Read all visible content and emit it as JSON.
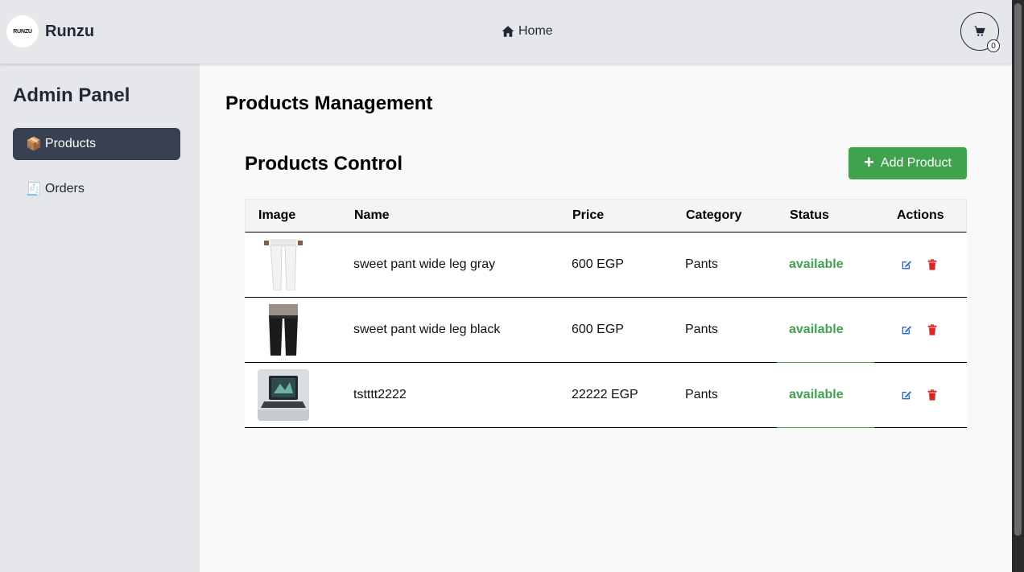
{
  "navbar": {
    "logo_text": "RUNZU",
    "brand": "Runzu",
    "home_label": "Home",
    "cart_count": "0"
  },
  "sidebar": {
    "title": "Admin Panel",
    "items": [
      {
        "emoji": "📦",
        "label": "Products",
        "active": true
      },
      {
        "emoji": "🧾",
        "label": "Orders",
        "active": false
      }
    ]
  },
  "main": {
    "page_title": "Products Management",
    "section_title": "Products Control",
    "add_button_label": "Add Product",
    "table": {
      "headers": [
        "Image",
        "Name",
        "Price",
        "Category",
        "Status",
        "Actions"
      ],
      "rows": [
        {
          "name": "sweet pant wide leg gray",
          "price": "600 EGP",
          "category": "Pants",
          "status": "available"
        },
        {
          "name": "sweet pant wide leg black",
          "price": "600 EGP",
          "category": "Pants",
          "status": "available"
        },
        {
          "name": "tstttt2222",
          "price": "22222 EGP",
          "category": "Pants",
          "status": "available"
        }
      ]
    }
  },
  "colors": {
    "accent_green": "#3fa34d",
    "edit_blue": "#2563eb",
    "delete_red": "#dc2626",
    "sidebar_active": "#374151"
  }
}
